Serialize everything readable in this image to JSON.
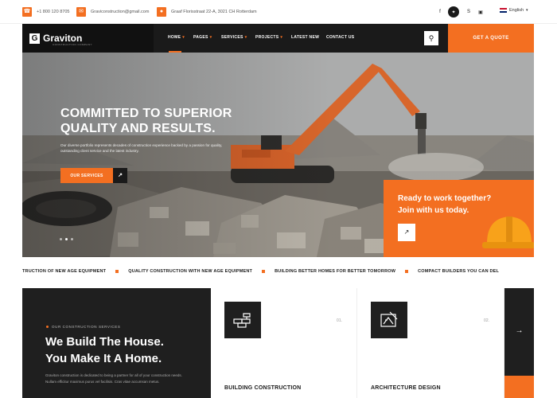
{
  "topbar": {
    "phone": "+1 800 120 8705",
    "email": "Graviconstruction@gmail.com",
    "address": "Graaf Florisstraat 22-A, 3021 CH Rotterdam",
    "language": "English"
  },
  "brand": {
    "name": "Graviton",
    "tagline": "CONSTRUCTION COMPANY"
  },
  "nav": {
    "items": [
      {
        "label": "HOME",
        "has_caret": true
      },
      {
        "label": "PAGES",
        "has_caret": true
      },
      {
        "label": "SERVICES",
        "has_caret": true
      },
      {
        "label": "PROJECTS",
        "has_caret": true
      },
      {
        "label": "LATEST NEW",
        "has_caret": false
      },
      {
        "label": "CONTACT US",
        "has_caret": false
      }
    ],
    "quote_label": "GET A QUOTE"
  },
  "hero": {
    "title_line1": "COMMITTED TO SUPERIOR",
    "title_line2": "QUALITY AND RESULTS.",
    "description": "Our diverse portfolio represents decades of construction experience backed by a passion for quality, outstanding client service and the latest industry.",
    "button_label": "OUR SERVICES",
    "slide_count": 3,
    "active_slide": 2
  },
  "ready": {
    "line1": "Ready to work together?",
    "line2": "Join with us today."
  },
  "ticker": [
    "TRUCTION OF NEW AGE EQUIPMENT",
    "QUALITY CONSTRUCTION WITH NEW AGE EQUIPMENT",
    "BUILDING BETTER HOMES FOR BETTER TOMORROW",
    "COMPACT BUILDERS YOU CAN DEL"
  ],
  "services": {
    "eyebrow": "OUR CONSTRUCTION SERVICES",
    "title_line1": "We Build The House.",
    "title_line2": "You Make It A Home.",
    "description": "Graviton construction is dedicated to being a partner for all of your construction needs. Nullam efficitur maximus purus vel facilisis. Cras vitae accumsan metus."
  },
  "cards": [
    {
      "number": "01.",
      "title": "BUILDING CONSTRUCTION",
      "icon": "bricks-icon"
    },
    {
      "number": "02.",
      "title": "ARCHITECTURE DESIGN",
      "icon": "blueprint-icon"
    }
  ],
  "colors": {
    "accent": "#f36f21",
    "dark": "#1f1f1f"
  }
}
